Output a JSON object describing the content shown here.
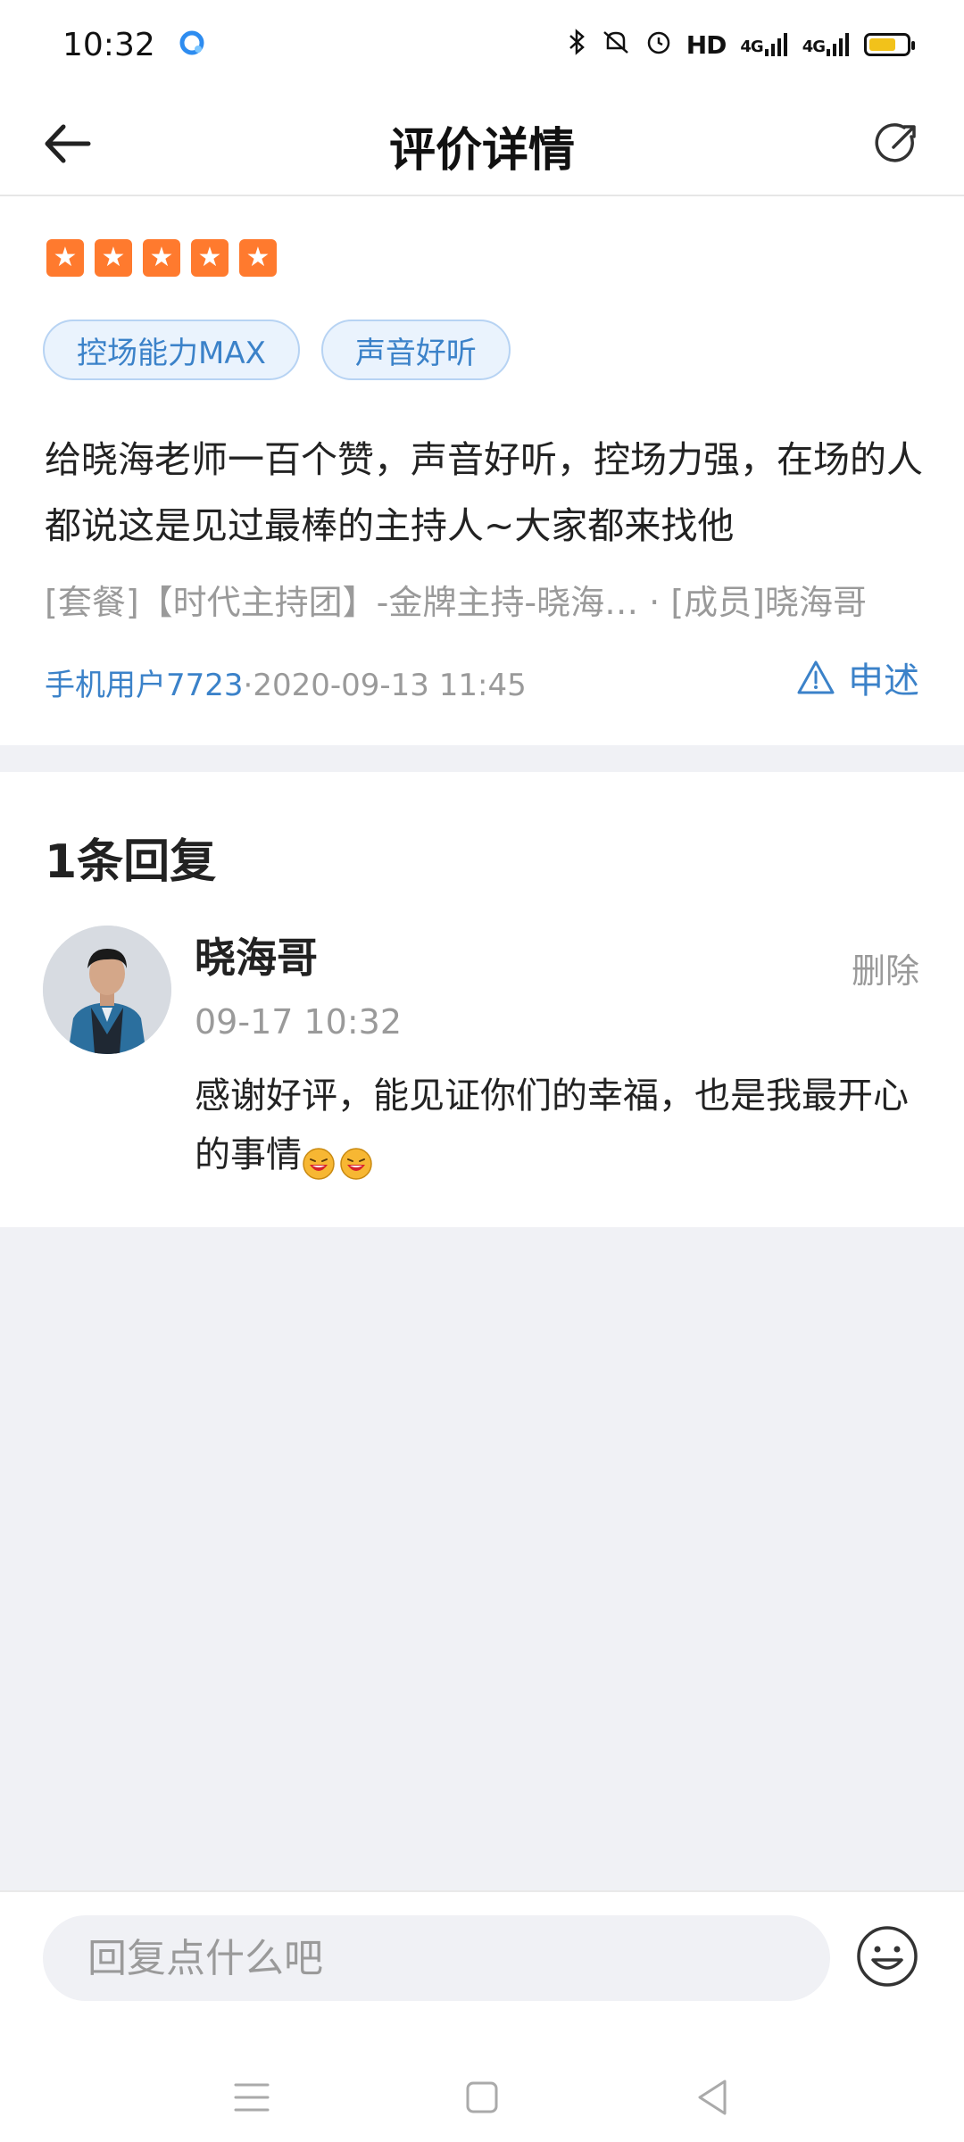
{
  "status_bar": {
    "time": "10:32",
    "hd_label": "HD",
    "net1": "4G",
    "net2": "4G"
  },
  "header": {
    "title": "评价详情"
  },
  "review": {
    "rating": 5,
    "tags": [
      "控场能力MAX",
      "声音好听"
    ],
    "text": "给晓海老师一百个赞，声音好听，控场力强，在场的人都说这是见过最棒的主持人~大家都来找他",
    "package_line": "[套餐]【时代主持团】-金牌主持-晓海…  · [成员]晓海哥",
    "user": "手机用户7723",
    "datetime": "·2020-09-13 11:45",
    "report_label": "申述"
  },
  "replies": {
    "count_label": "1条回复",
    "items": [
      {
        "name": "晓海哥",
        "time": "09-17 10:32",
        "delete_label": "删除",
        "text": "感谢好评，能见证你们的幸福，也是我最开心的事情"
      }
    ]
  },
  "input": {
    "placeholder": "回复点什么吧"
  },
  "colors": {
    "accent": "#3b82c9",
    "star": "#ff7a2e",
    "tag_bg": "#eaf3fd",
    "page_bg": "#f0f1f5"
  },
  "icons": {
    "back": "arrow-left-icon",
    "share": "share-icon",
    "report": "warning-triangle-icon",
    "emoji": "smiley-icon"
  }
}
